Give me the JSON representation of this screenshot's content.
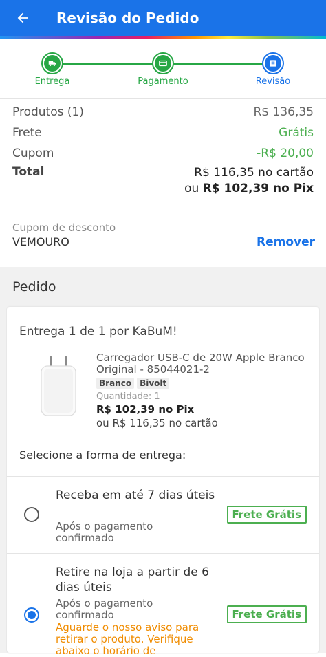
{
  "header": {
    "title": "Revisão do Pedido"
  },
  "steps": [
    {
      "label": "Entrega",
      "icon": "truck-icon",
      "state": "done"
    },
    {
      "label": "Pagamento",
      "icon": "card-icon",
      "state": "done"
    },
    {
      "label": "Revisão",
      "icon": "list-icon",
      "state": "active"
    }
  ],
  "summary": {
    "products_label": "Produtos (1)",
    "products_value": "R$ 136,35",
    "shipping_label": "Frete",
    "shipping_value": "Grátis",
    "coupon_label": "Cupom",
    "coupon_value": "-R$ 20,00",
    "total_label": "Total",
    "total_card": "R$ 116,35 no cartão",
    "total_pix_prefix": "ou ",
    "total_pix": "R$ 102,39 no Pix"
  },
  "coupon": {
    "caption": "Cupom de desconto",
    "code": "VEMOURO",
    "remove_label": "Remover"
  },
  "order": {
    "title": "Pedido",
    "delivery_title": "Entrega 1 de 1 por KaBuM!",
    "product": {
      "name": "Carregador USB-C de 20W Apple Branco Original - 85044021-2",
      "tags": [
        "Branco",
        "Bivolt"
      ],
      "quantity_label": "Quantidade:",
      "quantity": "1",
      "price_pix": "R$ 102,39 no Pix",
      "price_card": "ou R$ 116,35 no cartão"
    },
    "select_delivery_label": "Selecione a forma de entrega:",
    "options": [
      {
        "title": "Receba em até 7 dias úteis",
        "subtitle": "Após o pagamento confirmado",
        "badge": "Frete Grátis",
        "selected": false
      },
      {
        "title": "Retire na loja a partir de 6 dias úteis",
        "subtitle": "Após o pagamento confirmado",
        "warning": "Aguarde o nosso aviso para retirar o produto. Verifique abaixo o horário de",
        "badge": "Frete Grátis",
        "selected": true
      }
    ]
  },
  "colors": {
    "primary": "#1a73e8",
    "success": "#27a745",
    "free": "#4caf50",
    "warning": "#f08c00"
  }
}
